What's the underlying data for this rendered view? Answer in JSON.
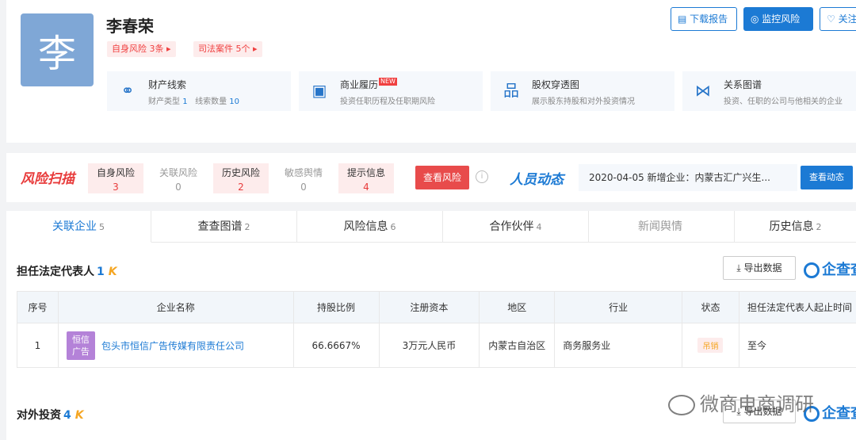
{
  "profile": {
    "avatar_char": "李",
    "name": "李春荣",
    "tags": [
      "自身风险 3条 ▸",
      "司法案件 5个 ▸"
    ]
  },
  "top_actions": {
    "download": "下载报告",
    "monitor": "监控风险",
    "follow": "关注"
  },
  "features": [
    {
      "icon": "link-icon",
      "title": "财产线索",
      "desc_label1": "财产类型",
      "desc_val1": "1",
      "desc_label2": "线索数量",
      "desc_val2": "10"
    },
    {
      "icon": "briefcase-icon",
      "title": "商业履历",
      "badge": "NEW",
      "desc": "投资任职历程及任职期风险"
    },
    {
      "icon": "org-chart-icon",
      "title": "股权穿透图",
      "desc": "展示股东持股和对外投资情况"
    },
    {
      "icon": "share-icon",
      "title": "关系图谱",
      "desc": "投资、任职的公司与他相关的企业"
    }
  ],
  "risk_scan": {
    "logo": "风险扫描",
    "cells": [
      {
        "label": "自身风险",
        "value": "3"
      },
      {
        "label": "关联风险",
        "value": "0"
      },
      {
        "label": "历史风险",
        "value": "2"
      },
      {
        "label": "敏感舆情",
        "value": "0"
      },
      {
        "label": "提示信息",
        "value": "4"
      }
    ],
    "button": "查看风险"
  },
  "dynamics": {
    "logo": "人员动态",
    "text": "2020-04-05 新增企业：内蒙古汇广兴生...",
    "button": "查看动态"
  },
  "tabs": [
    {
      "label": "关联企业",
      "count": "5"
    },
    {
      "label": "查查图谱",
      "count": "2"
    },
    {
      "label": "风险信息",
      "count": "6"
    },
    {
      "label": "合作伙伴",
      "count": "4"
    },
    {
      "label": "新闻舆情",
      "count": ""
    },
    {
      "label": "历史信息",
      "count": "2"
    }
  ],
  "section1": {
    "title": "担任法定代表人",
    "count": "1",
    "export": "导出数据",
    "brand": "企查查"
  },
  "table": {
    "headers": [
      "序号",
      "企业名称",
      "持股比例",
      "注册资本",
      "地区",
      "行业",
      "状态",
      "担任法定代表人起止时间"
    ],
    "rows": [
      {
        "index": "1",
        "logo_line1": "恒信",
        "logo_line2": "广告",
        "company": "包头市恒信广告传媒有限责任公司",
        "ratio": "66.6667%",
        "capital": "3万元人民币",
        "region": "内蒙古自治区",
        "industry": "商务服务业",
        "status": "吊销",
        "period": "至今"
      }
    ]
  },
  "section2": {
    "title": "对外投资",
    "count": "4",
    "export": "导出数据",
    "brand": "企查查"
  },
  "watermark": "微商电商调研"
}
